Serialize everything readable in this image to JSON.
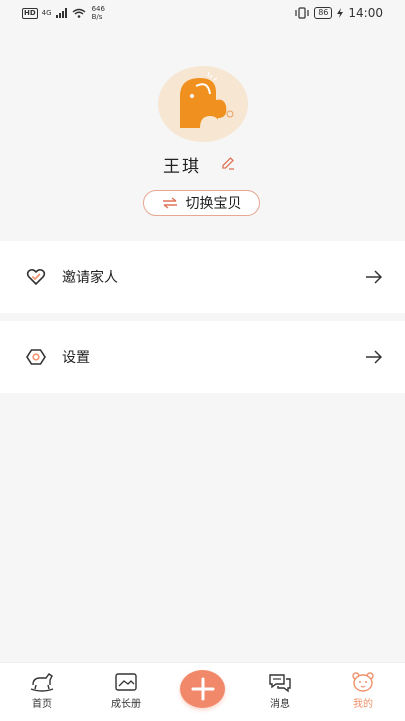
{
  "status_bar": {
    "hd": "HD",
    "network": "4G",
    "speed_value": "646",
    "speed_unit": "B/s",
    "battery": "86",
    "time": "14:00"
  },
  "profile": {
    "name": "王琪",
    "switch_label": "切换宝贝"
  },
  "menu": [
    {
      "label": "邀请家人",
      "icon": "heart-check-icon"
    },
    {
      "label": "设置",
      "icon": "hexagon-gear-icon"
    }
  ],
  "tab_bar": {
    "items": [
      {
        "label": "首页",
        "icon": "rocking-horse-icon"
      },
      {
        "label": "成长册",
        "icon": "photo-album-icon"
      },
      {
        "label": "",
        "icon": "plus-icon"
      },
      {
        "label": "消息",
        "icon": "chat-bubbles-icon"
      },
      {
        "label": "我的",
        "icon": "bear-face-icon",
        "active": true
      }
    ]
  },
  "colors": {
    "accent": "#f2886a",
    "active_tab": "#f0926b",
    "switch_border": "#e7a892",
    "page_bg": "#f6f6f6"
  }
}
